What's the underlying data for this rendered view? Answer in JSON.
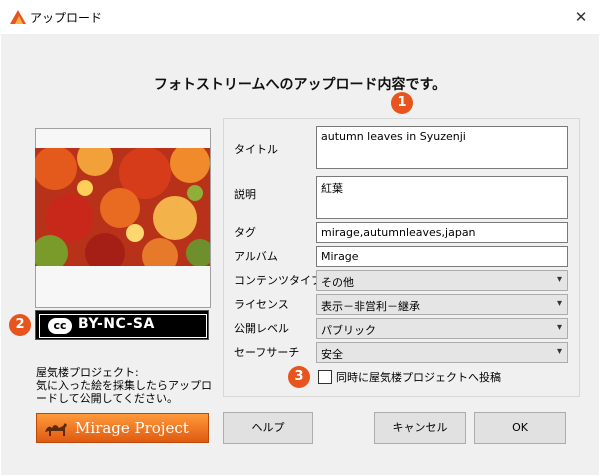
{
  "window": {
    "title": "アップロード",
    "close": "✕"
  },
  "heading": "フォトストリームへのアップロード内容です。",
  "markers": [
    "1",
    "2",
    "3"
  ],
  "license_badge": {
    "symbol": "cc",
    "text": "BY-NC-SA"
  },
  "project_note": "屋気楼プロジェクト:\n気に入った絵を採集したらアップロードして公開してください。",
  "mirage_button": {
    "label": "Mirage Project"
  },
  "form": {
    "title_label": "タイトル",
    "title_value": "autumn leaves in Syuzenji",
    "desc_label": "説明",
    "desc_value": "紅葉",
    "tags_label": "タグ",
    "tags_value": "mirage,autumnleaves,japan",
    "album_label": "アルバム",
    "album_value": "Mirage",
    "content_type_label": "コンテンツタイプ",
    "content_type_value": "その他",
    "license_label": "ライセンス",
    "license_value": "表示－非営利－継承",
    "visibility_label": "公開レベル",
    "visibility_value": "パブリック",
    "safe_search_label": "セーフサーチ",
    "safe_search_value": "安全",
    "share_checkbox_label": "同時に屋気楼プロジェクトへ投稿",
    "share_checked": false
  },
  "buttons": {
    "help": "ヘルプ",
    "cancel": "キャンセル",
    "ok": "OK"
  },
  "colors": {
    "accent": "#e8541d",
    "dialog_bg": "#f0f0f0"
  }
}
